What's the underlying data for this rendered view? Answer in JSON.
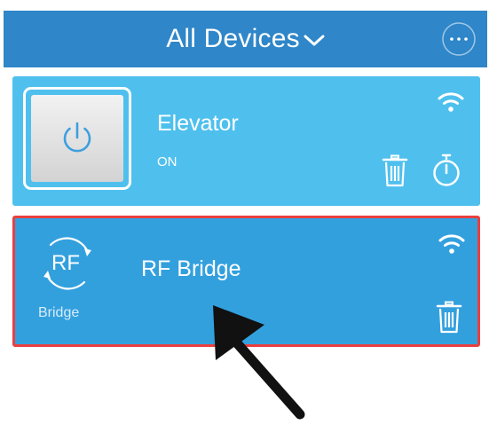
{
  "header": {
    "title": "All Devices",
    "menu_icon": "chevron-down-icon",
    "more_icon": "more-dots-icon"
  },
  "devices": [
    {
      "name": "Elevator",
      "status": "ON",
      "icon": "power-icon",
      "signal_icon": "wifi-icon",
      "actions": [
        "trash-icon",
        "timer-icon"
      ]
    },
    {
      "name": "RF Bridge",
      "icon_text": "RF",
      "icon_label": "Bridge",
      "icon": "rf-bridge-icon",
      "signal_icon": "wifi-icon",
      "actions": [
        "trash-icon"
      ],
      "highlighted": true
    }
  ],
  "annotation": {
    "icon": "arrow-icon"
  },
  "colors": {
    "header": "#2f86c8",
    "elevator_card": "#4fc0ee",
    "bridge_card": "#33a0de",
    "highlight_border": "#e8403f",
    "power_button": "#e4e4e4",
    "power_glyph": "#3d9fde",
    "arrow": "#111111"
  }
}
